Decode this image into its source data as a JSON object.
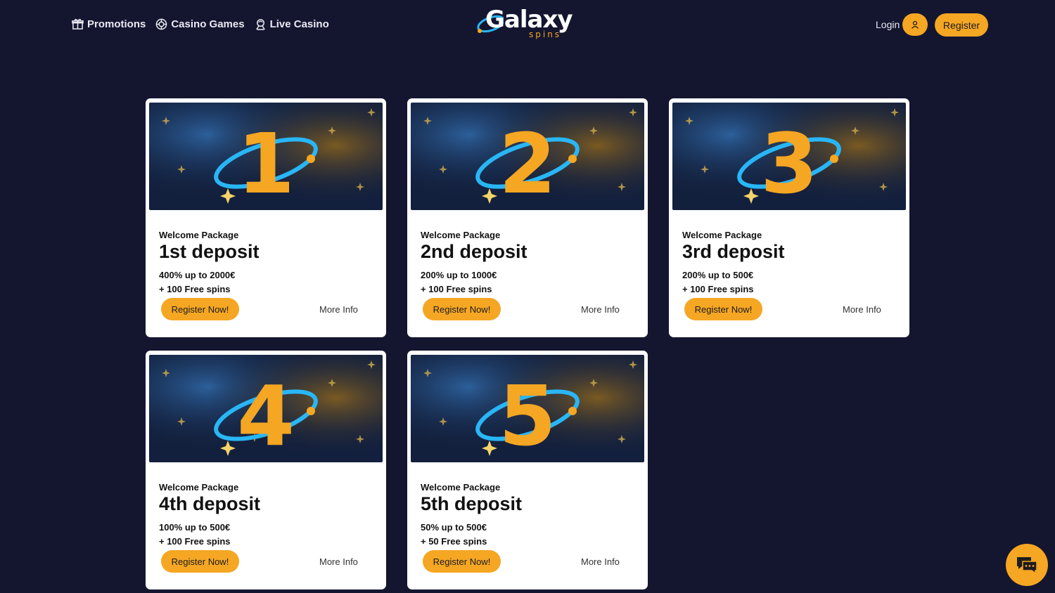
{
  "header": {
    "nav": [
      {
        "label": "Promotions",
        "icon": "gift-icon"
      },
      {
        "label": "Casino Games",
        "icon": "casino-chip-icon"
      },
      {
        "label": "Live Casino",
        "icon": "dealer-icon"
      }
    ],
    "logo": {
      "main": "Galaxy",
      "sub": "spins"
    },
    "login_label": "Login",
    "register_label": "Register"
  },
  "cards": [
    {
      "number": "1",
      "kicker": "Welcome Package",
      "title": "1st deposit",
      "bonus": "400% up to 2000€",
      "spins": "+ 100 Free spins",
      "register": "Register Now!",
      "more": "More Info"
    },
    {
      "number": "2",
      "kicker": "Welcome Package",
      "title": "2nd deposit",
      "bonus": "200% up to 1000€",
      "spins": "+ 100 Free spins",
      "register": "Register Now!",
      "more": "More Info"
    },
    {
      "number": "3",
      "kicker": "Welcome Package",
      "title": "3rd deposit",
      "bonus": "200% up to 500€",
      "spins": "+ 100 Free spins",
      "register": "Register Now!",
      "more": "More Info"
    },
    {
      "number": "4",
      "kicker": "Welcome Package",
      "title": "4th deposit",
      "bonus": "100% up to 500€",
      "spins": "+ 100 Free spins",
      "register": "Register Now!",
      "more": "More Info"
    },
    {
      "number": "5",
      "kicker": "Welcome Package",
      "title": "5th deposit",
      "bonus": "50% up to 500€",
      "spins": "+ 50 Free spins",
      "register": "Register Now!",
      "more": "More Info"
    }
  ],
  "colors": {
    "background": "#141630",
    "accent": "#f5a623",
    "card": "#ffffff",
    "orbit": "#29b6f6"
  },
  "chat": {
    "icon": "chat-icon"
  }
}
